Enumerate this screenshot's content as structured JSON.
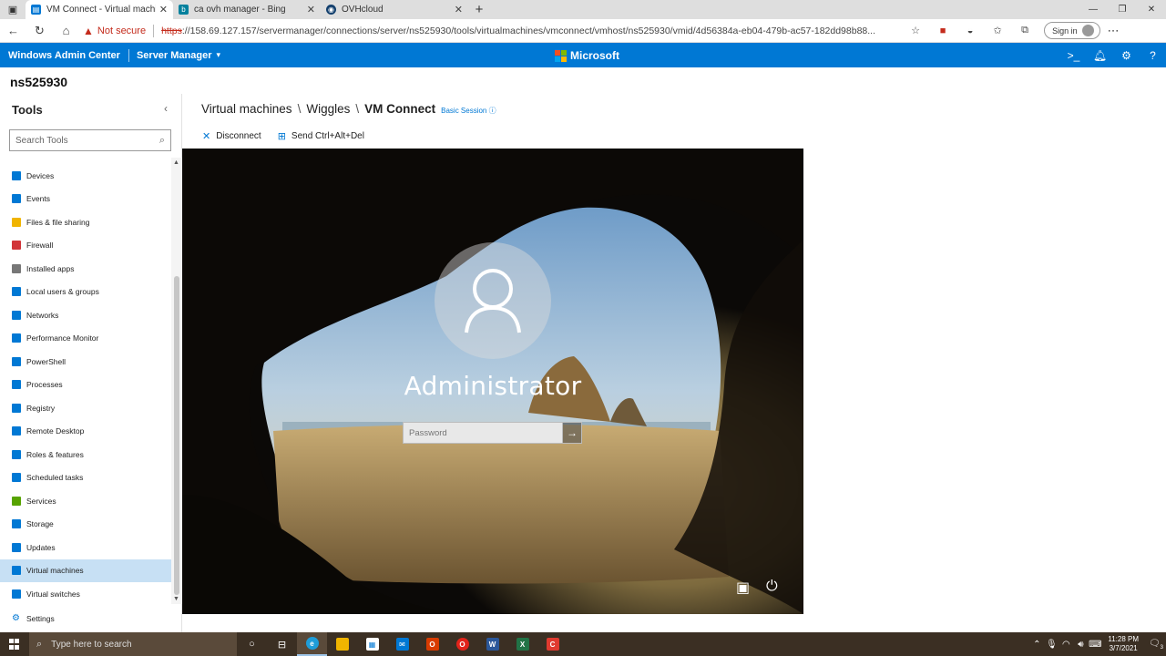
{
  "browser": {
    "tabs": [
      {
        "label": "VM Connect - Virtual machines",
        "active": true,
        "favicon_color": "#0078d4"
      },
      {
        "label": "ca ovh manager - Bing",
        "active": false,
        "favicon_color": "#00809d"
      },
      {
        "label": "OVHcloud",
        "active": false,
        "favicon_color": "#123f6d"
      }
    ],
    "security_label": "Not secure",
    "url_scheme": "https",
    "url_rest": "://158.69.127.157/servermanager/connections/server/ns525930/tools/virtualmachines/vmconnect/vmhost/ns525930/vmid/4d56384a-eb04-479b-ac57-182dd98b88...",
    "signin_label": "Sign in"
  },
  "wac": {
    "app_title": "Windows Admin Center",
    "server_manager_label": "Server Manager",
    "brand": "Microsoft",
    "brand_colors": [
      "#f25022",
      "#7fba00",
      "#00a4ef",
      "#ffb900"
    ],
    "accent": "#0078d4"
  },
  "server_name": "ns525930",
  "sidebar": {
    "title": "Tools",
    "search_placeholder": "Search Tools",
    "tools": [
      {
        "label": "Devices",
        "icon": "devices-icon",
        "color": "#0078d4"
      },
      {
        "label": "Events",
        "icon": "events-icon",
        "color": "#0078d4"
      },
      {
        "label": "Files & file sharing",
        "icon": "folder-icon",
        "color": "#f0b400"
      },
      {
        "label": "Firewall",
        "icon": "firewall-icon",
        "color": "#d13438"
      },
      {
        "label": "Installed apps",
        "icon": "list-icon",
        "color": "#777777"
      },
      {
        "label": "Local users & groups",
        "icon": "users-icon",
        "color": "#0078d4"
      },
      {
        "label": "Networks",
        "icon": "network-icon",
        "color": "#0078d4"
      },
      {
        "label": "Performance Monitor",
        "icon": "performance-icon",
        "color": "#0078d4"
      },
      {
        "label": "PowerShell",
        "icon": "powershell-icon",
        "color": "#0078d4"
      },
      {
        "label": "Processes",
        "icon": "processes-icon",
        "color": "#0078d4"
      },
      {
        "label": "Registry",
        "icon": "registry-icon",
        "color": "#0078d4"
      },
      {
        "label": "Remote Desktop",
        "icon": "remote-desktop-icon",
        "color": "#0078d4"
      },
      {
        "label": "Roles & features",
        "icon": "roles-icon",
        "color": "#0078d4"
      },
      {
        "label": "Scheduled tasks",
        "icon": "scheduled-tasks-icon",
        "color": "#0078d4"
      },
      {
        "label": "Services",
        "icon": "services-icon",
        "color": "#57a300"
      },
      {
        "label": "Storage",
        "icon": "storage-icon",
        "color": "#0078d4"
      },
      {
        "label": "Updates",
        "icon": "updates-icon",
        "color": "#0078d4"
      },
      {
        "label": "Virtual machines",
        "icon": "virtual-machines-icon",
        "color": "#0078d4",
        "active": true
      },
      {
        "label": "Virtual switches",
        "icon": "virtual-switches-icon",
        "color": "#0078d4"
      }
    ],
    "settings_label": "Settings"
  },
  "main": {
    "breadcrumb": [
      "Virtual machines",
      "Wiggles",
      "VM Connect"
    ],
    "session_label": "Basic Session",
    "actions": {
      "disconnect": "Disconnect",
      "send_cad": "Send Ctrl+Alt+Del"
    }
  },
  "vm_screen": {
    "user_name": "Administrator",
    "password_placeholder": "Password"
  },
  "taskbar": {
    "search_placeholder": "Type here to search",
    "time": "11:28 PM",
    "date": "3/7/2021",
    "notification_count": "3"
  }
}
